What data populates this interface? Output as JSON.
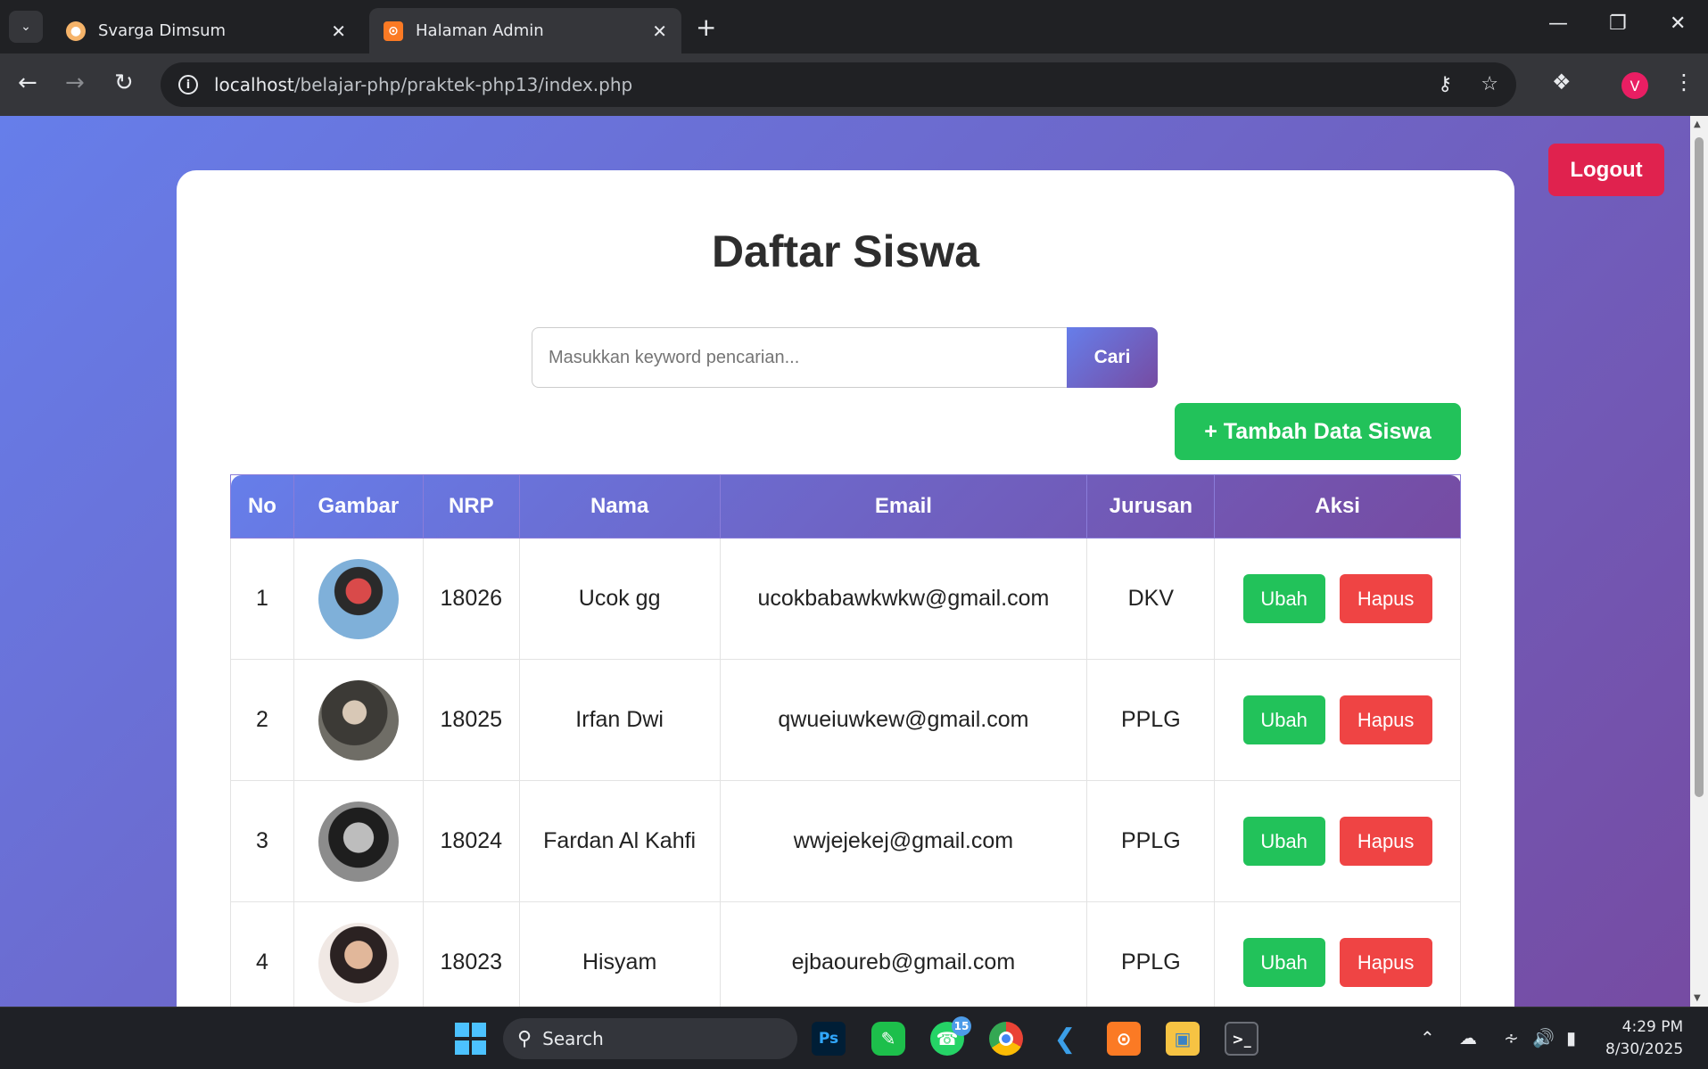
{
  "browser": {
    "tabs": [
      {
        "title": "Svarga Dimsum"
      },
      {
        "title": "Halaman Admin"
      }
    ],
    "url_host": "localhost",
    "url_path": "/belajar-php/praktek-php13/index.php",
    "profile_initial": "V"
  },
  "page": {
    "logout_label": "Logout",
    "title": "Daftar Siswa",
    "search": {
      "placeholder": "Masukkan keyword pencarian...",
      "button_label": "Cari"
    },
    "add_button_label": "+ Tambah Data Siswa",
    "table": {
      "headers": [
        "No",
        "Gambar",
        "NRP",
        "Nama",
        "Email",
        "Jurusan",
        "Aksi"
      ],
      "rows": [
        {
          "no": "1",
          "nrp": "18026",
          "nama": "Ucok gg",
          "email": "ucokbabawkwkw@gmail.com",
          "jurusan": "DKV",
          "ubah": "Ubah",
          "hapus": "Hapus"
        },
        {
          "no": "2",
          "nrp": "18025",
          "nama": "Irfan Dwi",
          "email": "qwueiuwkew@gmail.com",
          "jurusan": "PPLG",
          "ubah": "Ubah",
          "hapus": "Hapus"
        },
        {
          "no": "3",
          "nrp": "18024",
          "nama": "Fardan Al Kahfi",
          "email": "wwjejekej@gmail.com",
          "jurusan": "PPLG",
          "ubah": "Ubah",
          "hapus": "Hapus"
        },
        {
          "no": "4",
          "nrp": "18023",
          "nama": "Hisyam",
          "email": "ejbaoureb@gmail.com",
          "jurusan": "PPLG",
          "ubah": "Ubah",
          "hapus": "Hapus"
        }
      ]
    }
  },
  "taskbar": {
    "search_label": "Search",
    "whatsapp_badge": "15",
    "time": "4:29 PM",
    "date": "8/30/2025"
  }
}
